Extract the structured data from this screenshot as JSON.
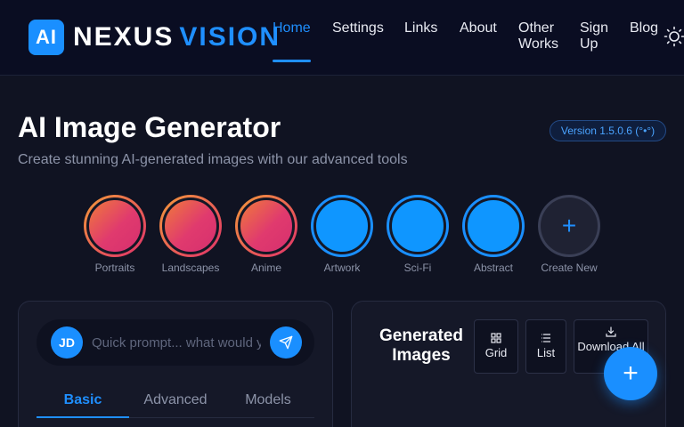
{
  "header": {
    "logo_badge": "AI",
    "logo_word1": "NEXUS",
    "logo_word2": "VISION",
    "nav": [
      {
        "label": "Home",
        "active": true
      },
      {
        "label": "Settings"
      },
      {
        "label": "Links"
      },
      {
        "label": "About"
      },
      {
        "label": "Other Works"
      },
      {
        "label": "Sign Up"
      },
      {
        "label": "Blog"
      }
    ],
    "theme_icon": "sun-icon"
  },
  "hero": {
    "title": "AI Image Generator",
    "subtitle": "Create stunning AI-generated images with our advanced tools",
    "version": "Version 1.5.0.6 (°•°)"
  },
  "categories": [
    {
      "label": "Portraits",
      "style": "warm"
    },
    {
      "label": "Landscapes",
      "style": "warm"
    },
    {
      "label": "Anime",
      "style": "warm"
    },
    {
      "label": "Artwork",
      "style": "cool"
    },
    {
      "label": "Sci-Fi",
      "style": "cool"
    },
    {
      "label": "Abstract",
      "style": "cool"
    },
    {
      "label": "Create New",
      "style": "new",
      "icon": "+"
    }
  ],
  "prompt": {
    "avatar": "JD",
    "placeholder": "Quick prompt... what would you like to create?",
    "send_icon": "send-icon"
  },
  "tabs": [
    {
      "label": "Basic",
      "active": true
    },
    {
      "label": "Advanced"
    },
    {
      "label": "Models"
    }
  ],
  "generated": {
    "title": "Generated Images",
    "grid_label": "Grid",
    "list_label": "List",
    "download_label": "Download All"
  },
  "fab": {
    "label": "+"
  },
  "colors": {
    "accent": "#1a8fff",
    "background": "#101322",
    "panel": "#151828"
  }
}
